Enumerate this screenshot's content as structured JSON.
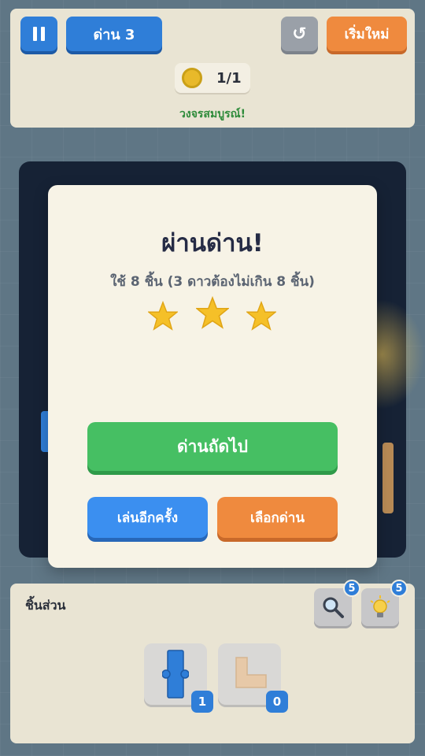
{
  "header": {
    "level_label": "ด่าน 3",
    "restart_label": "เริ่มใหม่",
    "coins": "1/1",
    "status": "วงจรสมบูรณ์!"
  },
  "dialog": {
    "title": "ผ่านด่าน!",
    "subtitle": "ใช้ 8 ชิ้น (3 ดาวต้องไม่เกิน 8 ชิ้น)",
    "stars_earned": 3,
    "stars_total": 3,
    "next_label": "ด่านถัดไป",
    "replay_label": "เล่นอีกครั้ง",
    "select_label": "เลือกด่าน"
  },
  "pieces_panel": {
    "label": "ชิ้นส่วน",
    "magnifier_count": "5",
    "hint_count": "5",
    "slots": [
      {
        "icon": "straight-pipe-icon",
        "count": "1"
      },
      {
        "icon": "corner-pipe-icon",
        "count": "0"
      }
    ]
  },
  "icons": {
    "pause": "pause-icon",
    "undo": "undo-icon",
    "coin": "coin-icon",
    "star": "star-icon",
    "magnifier": "magnifier-icon",
    "hint": "lightbulb-icon"
  },
  "colors": {
    "primary_blue": "#2f7ed8",
    "next_green": "#46bf63",
    "orange": "#ef8a3e",
    "status_green": "#2e8b3a",
    "star_gold": "#f5c028"
  }
}
